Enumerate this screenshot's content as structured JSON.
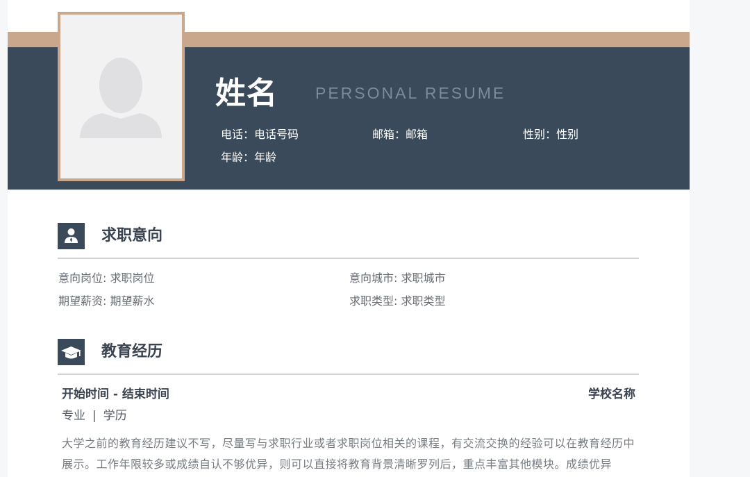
{
  "header": {
    "name": "姓名",
    "subtitle": "PERSONAL RESUME",
    "phone": "电话：电话号码",
    "email": "邮箱：邮箱",
    "gender": "性别：性别",
    "age": "年龄：年龄"
  },
  "colors": {
    "header_bg": "#3a4a5a",
    "accent_tan": "#c9a78c"
  },
  "job_intention": {
    "title": "求职意向",
    "icon": "person-icon",
    "position": "意向岗位: 求职岗位",
    "city": "意向城市: 求职城市",
    "salary": "期望薪资: 期望薪水",
    "type": "求职类型: 求职类型"
  },
  "education": {
    "title": "教育经历",
    "icon": "graduation-cap-icon",
    "time": "开始时间  -  结束时间",
    "school": "学校名称",
    "major": "专业",
    "separator": "|",
    "degree": "学历",
    "description": "大学之前的教育经历建议不写，尽量写与求职行业或者求职岗位相关的课程，有交流交换的经验可以在教育经历中展示。工作年限较多或成绩自认不够优异，则可以直接将教育背景清晰罗列后，重点丰富其他模块。成绩优异"
  }
}
